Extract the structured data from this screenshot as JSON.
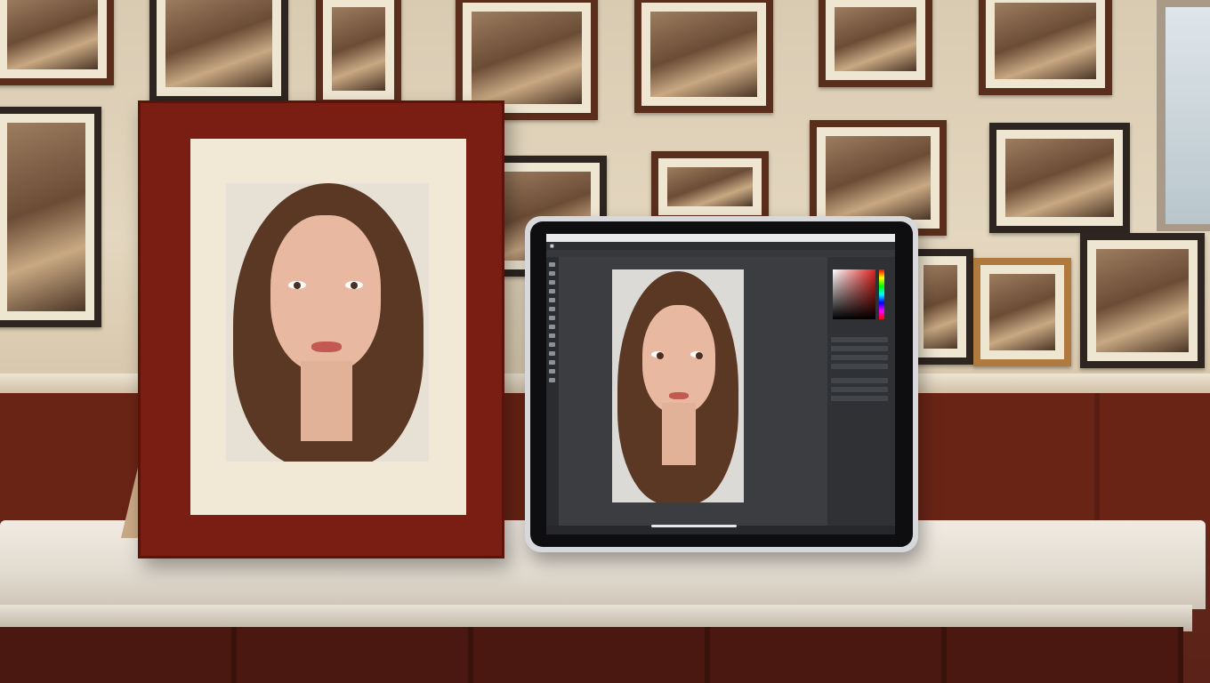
{
  "scene": {
    "description_tag": "photo-frame-and-tablet-on-marble-table",
    "colors": {
      "frame_wood": "#7a1e14",
      "wall": "#e4d7bf",
      "wainscot": "#6a2416",
      "marble": "#ece5db",
      "tablet_body": "#d6d8db",
      "editor_bg": "#3b3d41"
    }
  },
  "tablet": {
    "app_icon": "photo-editor-icon",
    "menu": [
      "",
      "",
      "",
      "",
      "",
      "",
      "",
      "",
      "",
      "",
      ""
    ]
  }
}
